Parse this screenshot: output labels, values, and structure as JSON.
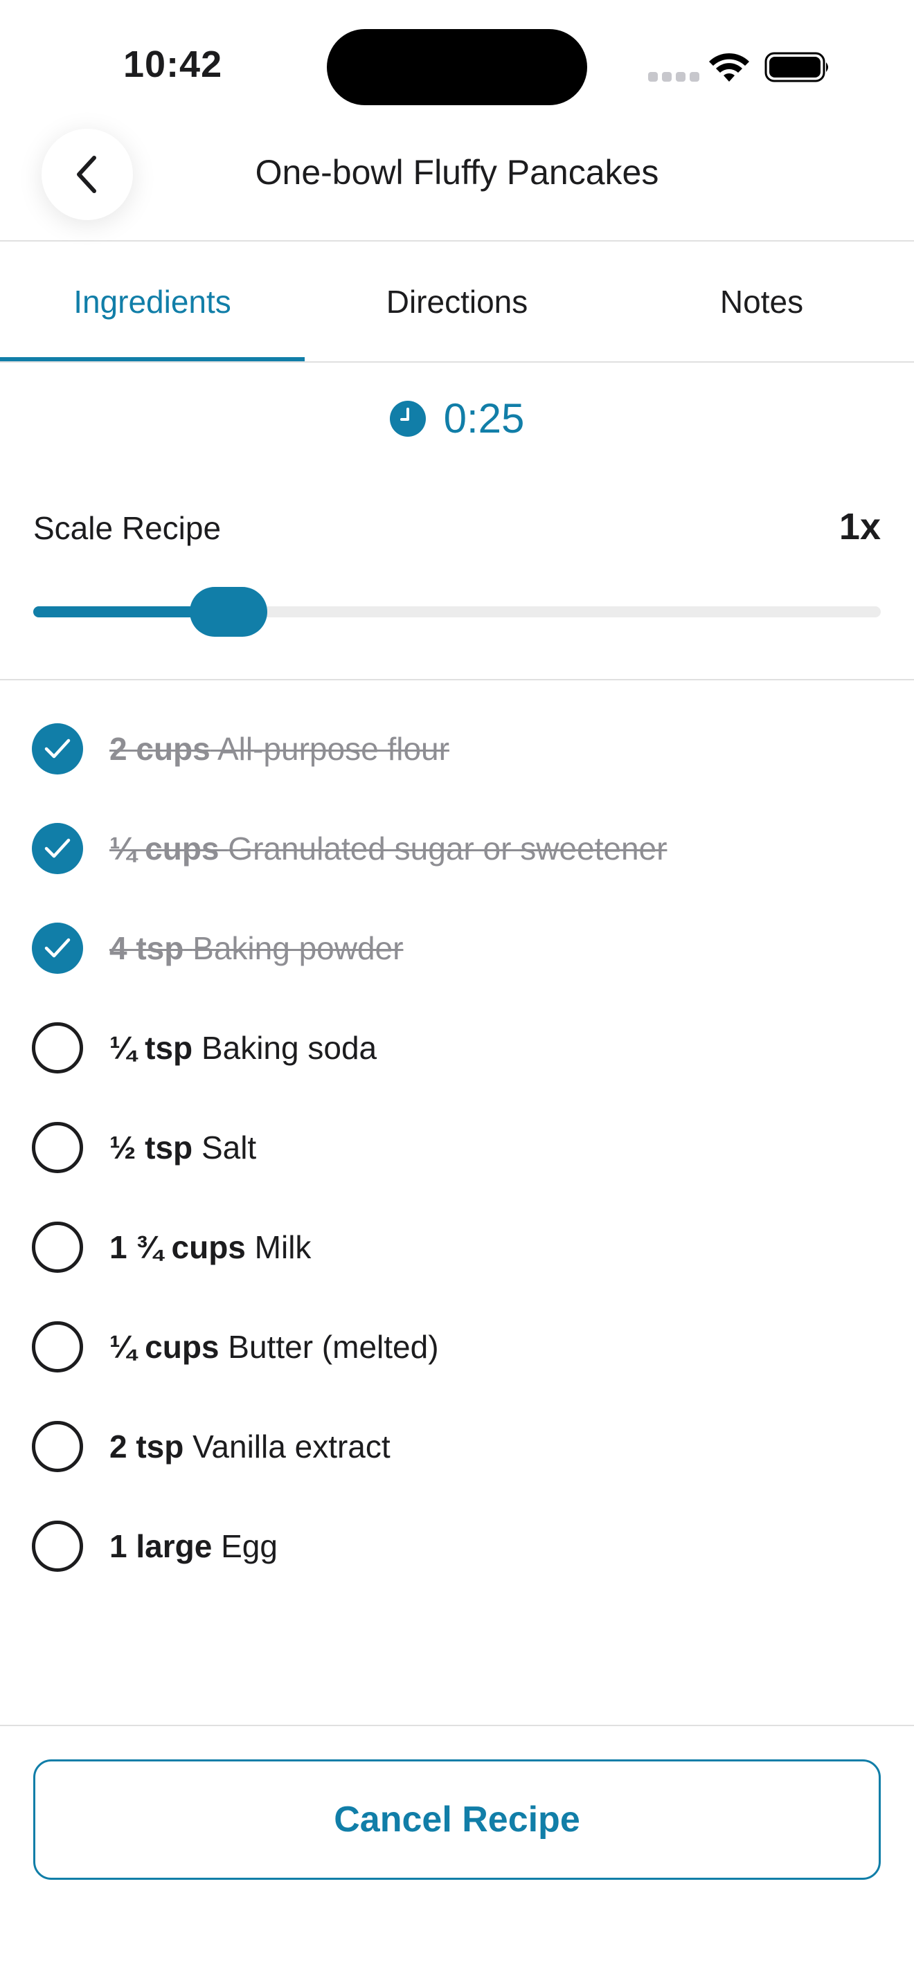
{
  "status_bar": {
    "time": "10:42"
  },
  "header": {
    "title": "One-bowl Fluffy Pancakes",
    "back_icon": "chevron-left-icon"
  },
  "tabs": [
    {
      "label": "Ingredients",
      "active": true
    },
    {
      "label": "Directions",
      "active": false
    },
    {
      "label": "Notes",
      "active": false
    }
  ],
  "timer": {
    "icon": "clock-icon",
    "value": "0:25"
  },
  "scale": {
    "label": "Scale Recipe",
    "value": "1x",
    "slider_fraction": 0.23
  },
  "ingredients": [
    {
      "qty": "2 cups",
      "name": "All-purpose flour",
      "checked": true
    },
    {
      "qty": "¼ cups",
      "name": "Granulated sugar or sweetener",
      "checked": true
    },
    {
      "qty": "4 tsp",
      "name": "Baking powder",
      "checked": true
    },
    {
      "qty": "¼ tsp",
      "name": "Baking soda",
      "checked": false
    },
    {
      "qty": "½ tsp",
      "name": "Salt",
      "checked": false
    },
    {
      "qty": "1 ¾ cups",
      "name": "Milk",
      "checked": false
    },
    {
      "qty": "¼ cups",
      "name": "Butter (melted)",
      "checked": false
    },
    {
      "qty": "2 tsp",
      "name": "Vanilla extract",
      "checked": false
    },
    {
      "qty": "1 large",
      "name": "Egg",
      "checked": false
    }
  ],
  "footer": {
    "cancel_label": "Cancel Recipe"
  },
  "colors": {
    "accent": "#117ea8",
    "text": "#1c1c1e",
    "muted": "#8e8e93",
    "divider": "#e0e0e0"
  }
}
